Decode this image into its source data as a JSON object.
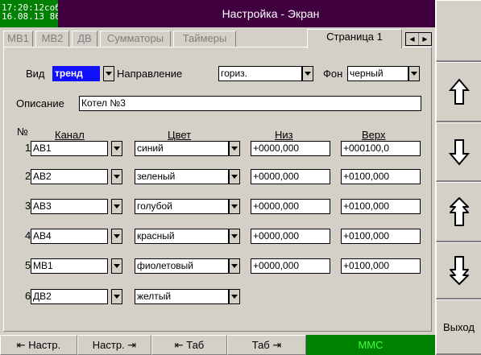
{
  "status": {
    "time": "17:20:12",
    "state": "собт",
    "date": "16.08.13",
    "battery": "86%"
  },
  "title": "Настройка - Экран",
  "tabs": [
    {
      "label": "МВ1",
      "active": false
    },
    {
      "label": "МВ2",
      "active": false
    },
    {
      "label": "ДВ",
      "active": false
    },
    {
      "label": "Сумматоры",
      "active": false
    },
    {
      "label": "Таймеры",
      "active": false
    },
    {
      "label": "Страница 1",
      "active": true
    }
  ],
  "settings": {
    "view_label": "Вид",
    "view_value": "тренд",
    "direction_label": "Направление",
    "direction_value": "гориз.",
    "background_label": "Фон",
    "background_value": "черный",
    "description_label": "Описание",
    "description_value": "Котел №3"
  },
  "table": {
    "headers": {
      "num": "№",
      "channel": "Канал",
      "color": "Цвет",
      "low": "Низ",
      "high": "Верх"
    },
    "rows": [
      {
        "num": "1",
        "channel": "АВ1",
        "color": "синий",
        "low": "+0000,000",
        "high": "+000100,0"
      },
      {
        "num": "2",
        "channel": "АВ2",
        "color": "зеленый",
        "low": "+0000,000",
        "high": "+0100,000"
      },
      {
        "num": "3",
        "channel": "АВ3",
        "color": "голубой",
        "low": "+0000,000",
        "high": "+0100,000"
      },
      {
        "num": "4",
        "channel": "АВ4",
        "color": "красный",
        "low": "+0000,000",
        "high": "+0100,000"
      },
      {
        "num": "5",
        "channel": "МВ1",
        "color": "фиолетовый",
        "low": "+0000,000",
        "high": "+0100,000"
      },
      {
        "num": "6",
        "channel": "ДВ2",
        "color": "желтый",
        "low": "",
        "high": ""
      }
    ]
  },
  "right_buttons": {
    "up_icon": "arrow-up-icon",
    "down_icon": "arrow-down-icon",
    "page_up_icon": "double-arrow-up-icon",
    "page_down_icon": "double-arrow-down-icon",
    "exit_label": "Выход"
  },
  "bottom": {
    "prev_settings": "⇤ Настр.",
    "next_settings": "Настр. ⇥",
    "prev_tab": "⇤ Таб",
    "next_tab": "Таб ⇥",
    "mmc": "MMC"
  },
  "colors": {
    "status_bg": "#008000",
    "title_bg": "#400040",
    "selected": "#1010ff",
    "mmc_text": "#40ff40",
    "window_bg": "#d4d0c8"
  }
}
